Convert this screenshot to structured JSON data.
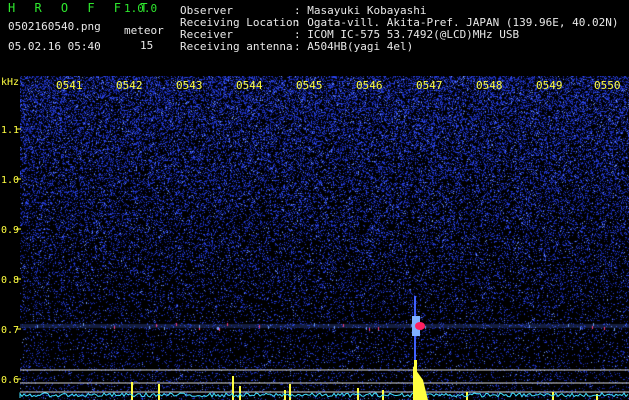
{
  "app": {
    "title": "H R O F F T",
    "version": "1.0.0",
    "filename": "0502160540.png",
    "mode_label": "meteor",
    "datetime": "05.02.16 05:40",
    "count": "15"
  },
  "info": {
    "labels": [
      "Observer",
      "Receiving Location",
      "Receiver",
      "Receiving antenna"
    ],
    "values": [
      ": Masayuki Kobayashi",
      ": Ogata-vill. Akita-Pref. JAPAN (139.96E, 40.02N)",
      ": ICOM IC-575 53.7492(@LCD)MHz USB",
      ": A504HB(yagi 4el)"
    ]
  },
  "axis": {
    "unit": "kHz",
    "time_ticks": [
      "0541",
      "0542",
      "0543",
      "0544",
      "0545",
      "0546",
      "0547",
      "0548",
      "0549",
      "0550"
    ],
    "freq_ticks": [
      "1.1",
      "1.0",
      "0.9",
      "0.8",
      "0.7",
      "0.6"
    ]
  },
  "colors": {
    "background": "#000000",
    "title": "#2ee82e",
    "text": "#e8e8e8",
    "axis_text": "#ffff40",
    "noise": "#2030c8",
    "meteor_echo": "#ff2060",
    "bottom_trace": "#40e0ff",
    "spikes": "#ffff40"
  }
}
